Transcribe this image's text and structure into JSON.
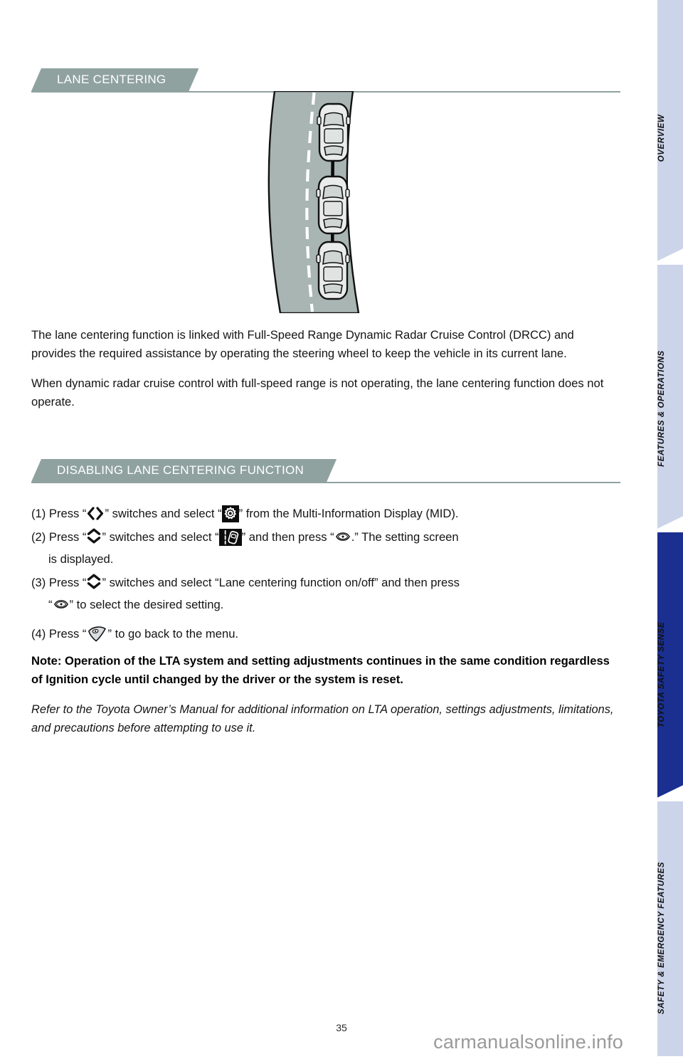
{
  "document": {
    "page_number": "35",
    "watermark": "carmanualsonline.info"
  },
  "sections": {
    "primary_heading": "LANE CENTERING",
    "secondary_heading": "DISABLING LANE CENTERING FUNCTION"
  },
  "figure": {
    "caption": "Top-down illustration of a curved road with a dashed white lane marking and three vehicles following a black trajectory arrow that stays centered in the lane.",
    "road_color": "#a8b5b2",
    "lane_marking_color": "#ffffff",
    "trajectory_color": "#000000"
  },
  "body": {
    "paragraph_1": "The lane centering function is linked with Full-Speed Range Dynamic Radar Cruise Control (DRCC) and provides the required assistance by operating the steering wheel to keep the vehicle in its current lane.",
    "paragraph_2": "When dynamic radar cruise control with full-speed range is not operating, the lane centering function does not operate."
  },
  "steps": {
    "step1": {
      "number": "(1)",
      "text_a": "Press “",
      "text_b": "” switches and select “",
      "text_c": "” from the Multi-Information Display (MID).",
      "icon_1": "left-right-switch-icon",
      "icon_2": "settings-gear-icon"
    },
    "step2": {
      "number": "(2)",
      "text_a": "Press “",
      "text_b": "” switches and select “",
      "text_c": "” and then press “",
      "text_d": ".” The setting screen",
      "continuation": "is displayed.",
      "icon_1": "up-down-switch-icon",
      "icon_2": "lane-departure-alert-icon",
      "icon_3": "enter-button-icon"
    },
    "step3": {
      "number": "(3)",
      "text_a": "Press “",
      "text_b": "” switches and select “Lane centering function on/off” and then press",
      "text_c": "“",
      "text_d": "” to select the desired setting.",
      "icon_1": "up-down-switch-icon",
      "icon_2": "enter-button-icon"
    },
    "step4": {
      "number": "(4)",
      "text_a": "Press “",
      "text_b": "” to go back to the menu.",
      "icon_1": "back-button-icon"
    }
  },
  "note": "Note: Operation of the LTA system and setting adjustments continues in the same condition regardless of Ignition cycle until changed by the driver or the system is reset.",
  "disclaimer": "Refer to the Toyota Owner’s Manual for additional information on LTA operation, settings adjustments, limitations, and precautions before attempting to use it.",
  "sidebar": {
    "tabs": [
      {
        "label": "OVERVIEW",
        "active": false
      },
      {
        "label": "FEATURES & OPERATIONS",
        "active": false
      },
      {
        "label": "TOYOTA SAFETY SENSE",
        "active": true
      },
      {
        "label": "SAFETY & EMERGENCY FEATURES",
        "active": false
      }
    ],
    "inactive_color": "#ccd4ea",
    "active_color": "#1a2f8f"
  }
}
